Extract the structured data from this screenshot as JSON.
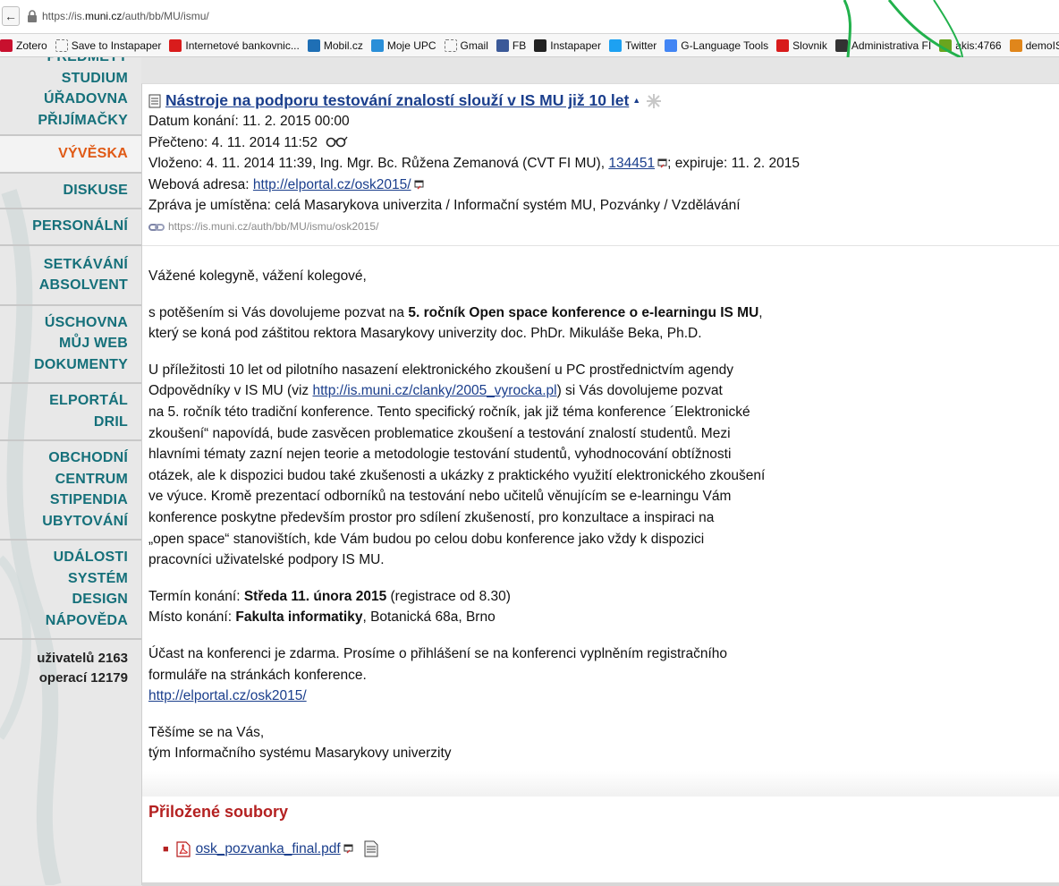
{
  "browser": {
    "url_prefix": "https://is.",
    "url_host": "muni.cz",
    "url_path": "/auth/bb/MU/ismu/"
  },
  "bookmarks": [
    {
      "label": "Zotero",
      "icon": "zotero-icon",
      "color": "#c8102e"
    },
    {
      "label": "Save to Instapaper",
      "icon": "dotted-page-icon",
      "color": ""
    },
    {
      "label": "Internetové bankovnic...",
      "icon": "bank-icon",
      "color": "#d91c1c"
    },
    {
      "label": "Mobil.cz",
      "icon": "mobil-icon",
      "color": "#1f6fb5"
    },
    {
      "label": "Moje UPC",
      "icon": "upc-icon",
      "color": "#2a8fd8"
    },
    {
      "label": "Gmail",
      "icon": "dotted-page-icon",
      "color": ""
    },
    {
      "label": "FB",
      "icon": "facebook-icon",
      "color": "#3b5998"
    },
    {
      "label": "Instapaper",
      "icon": "instapaper-icon",
      "color": "#222222"
    },
    {
      "label": "Twitter",
      "icon": "twitter-icon",
      "color": "#1da1f2"
    },
    {
      "label": "G-Language Tools",
      "icon": "google-icon",
      "color": "#4285f4"
    },
    {
      "label": "Slovnik",
      "icon": "slovnik-icon",
      "color": "#d81b1b"
    },
    {
      "label": "Administrativa FI",
      "icon": "administrativa-icon",
      "color": "#333333"
    },
    {
      "label": "akis:4766",
      "icon": "is-icon",
      "color": "#6aa51e"
    },
    {
      "label": "demoIS",
      "icon": "is-icon",
      "color": "#e0861b"
    }
  ],
  "sidebar": {
    "groups": [
      {
        "items": [
          "PŘEDMĚTY",
          "STUDIUM",
          "ÚŘADOVNA",
          "PŘIJÍMAČKY"
        ],
        "active": false
      },
      {
        "items": [
          "VÝVĚSKA"
        ],
        "active": true
      },
      {
        "items": [
          "DISKUSE"
        ],
        "active": false
      },
      {
        "items": [
          "PERSONÁLNÍ"
        ],
        "active": false
      },
      {
        "items": [
          "SETKÁVÁNÍ",
          "ABSOLVENT"
        ],
        "active": false
      },
      {
        "items": [
          "ÚSCHOVNA",
          "MŮJ WEB",
          "DOKUMENTY"
        ],
        "active": false
      },
      {
        "items": [
          "ELPORTÁL",
          "DRIL"
        ],
        "active": false
      },
      {
        "items": [
          "OBCHODNÍ",
          "CENTRUM",
          "STIPENDIA",
          "UBYTOVÁNÍ"
        ],
        "active": false
      },
      {
        "items": [
          "UDÁLOSTI",
          "SYSTÉM",
          "DESIGN",
          "NÁPOVĚDA"
        ],
        "active": false
      }
    ],
    "stats": [
      "uživatelů 2163",
      "operací 12179"
    ]
  },
  "article": {
    "title": "Nástroje na podporu testování znalostí slouží v IS MU již 10 let",
    "date_label": "Datum konání: ",
    "date_value": "11. 2. 2015 00:00",
    "read_label": "Přečteno: ",
    "read_value": "4. 11. 2014 11:52",
    "posted_text": "Vloženo: 4. 11. 2014 11:39, Ing. Mgr. Bc. Růžena Zemanová (CVT FI MU), ",
    "posted_uco": "134451",
    "expiry_text": "; expiruje: 11. 2. 2015",
    "web_label": "Webová adresa: ",
    "web_url": "http://elportal.cz/osk2015/",
    "placement": "Zpráva je umístěna: celá Masarykova univerzita / Informační systém MU, Pozvánky / Vzdělávání",
    "permalink": "https://is.muni.cz/auth/bb/MU/ismu/osk2015/"
  },
  "body": {
    "greeting": "Vážené kolegyně, vážení kolegové,",
    "p1_pre": "s potěšením si Vás dovolujeme pozvat na ",
    "p1_bold": "5. ročník Open space konference o e-learningu IS MU",
    "p1_post": ",",
    "p1_line2": "který se koná pod záštitou rektora Masarykovy univerzity doc. PhDr. Mikuláše Beka, Ph.D.",
    "p2_line1": "U příležitosti 10 let od pilotního nasazení elektronického zkoušení u PC prostřednictvím agendy",
    "p2_line2_pre": "Odpovědníky v IS MU (viz ",
    "p2_link": "http://is.muni.cz/clanky/2005_vyrocka.pl",
    "p2_line2_post": ") si Vás dovolujeme pozvat",
    "p2_lines": [
      "na 5. ročník této tradiční konference. Tento specifický ročník, jak již téma konference ´Elektronické",
      "zkoušení“ napovídá, bude zasvěcen problematice zkoušení a testování znalostí studentů. Mezi",
      "hlavními tématy zazní nejen teorie a metodologie testování studentů, vyhodnocování obtížnosti",
      "otázek, ale k dispozici budou také zkušenosti a ukázky z praktického využití elektronického zkoušení",
      "ve výuce. Kromě prezentací odborníků na testování nebo učitelů věnujícím se e-learningu Vám",
      "konference poskytne především prostor pro sdílení zkušeností, pro konzultace a inspiraci na",
      "„open space“ stanovištích, kde Vám budou po celou dobu konference jako vždy k dispozici",
      "pracovníci uživatelské podpory IS MU."
    ],
    "term_label": "Termín konání: ",
    "term_bold": "Středa 11. února 2015",
    "term_post": " (registrace od 8.30)",
    "place_label": "Místo konání: ",
    "place_bold": "Fakulta informatiky",
    "place_post": ", Botanická 68a, Brno",
    "p4_line1": "Účast na konferenci je zdarma. Prosíme o přihlášení se na konferenci vyplněním registračního",
    "p4_line2": "formuláře na stránkách konference.",
    "p4_link": "http://elportal.cz/osk2015/",
    "closing_line1": "Těšíme se na Vás,",
    "closing_line2": "tým Informačního systému Masarykovy univerzity"
  },
  "attachments": {
    "title": "Přiložené soubory",
    "files": [
      {
        "name": "osk_pozvanka_final.pdf"
      }
    ]
  },
  "colors": {
    "nav_text": "#15707a",
    "nav_active": "#e05a16",
    "link": "#1a3e8c",
    "attach_title": "#b42121"
  }
}
